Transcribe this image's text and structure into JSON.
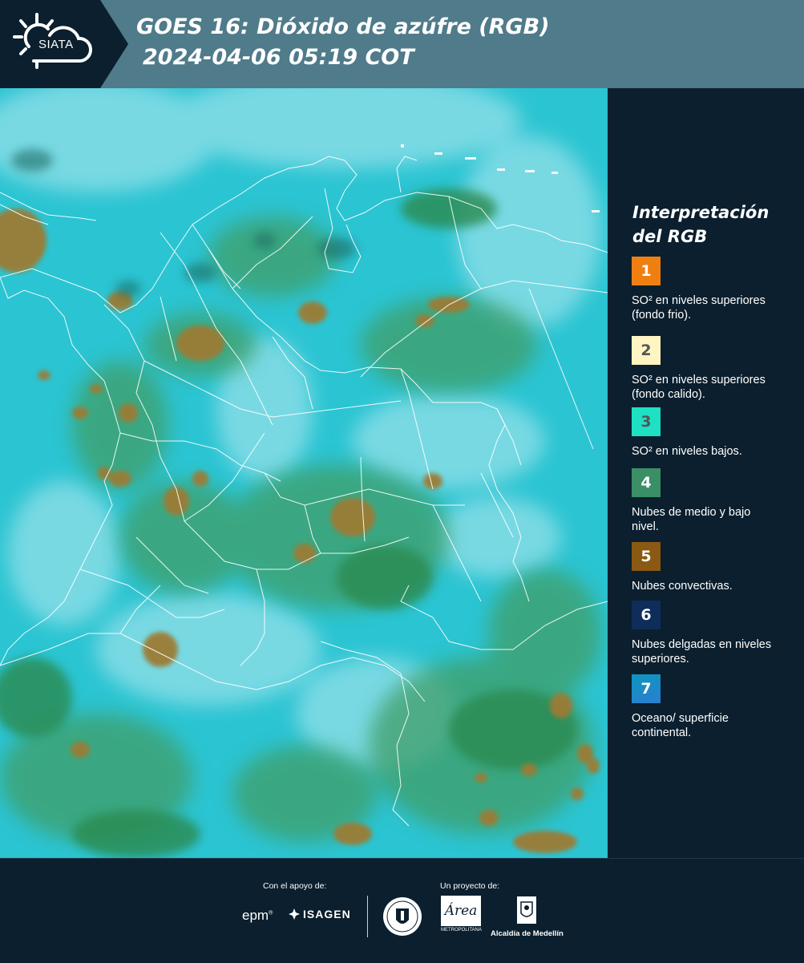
{
  "header": {
    "logo_text": "SIATA",
    "title_line1": "GOES 16: Dióxido de azúfre (RGB)",
    "title_line2": "2024-04-06 05:19 COT"
  },
  "legend": {
    "title_line1": "Interpretación",
    "title_line2": "del RGB",
    "items": [
      {
        "number": "1",
        "color": "#f07f12",
        "text_color": "#ffffff",
        "label": "SO² en niveles superiores (fondo frio)."
      },
      {
        "number": "2",
        "color": "#fff5c2",
        "text_color": "#555555",
        "label": "SO² en niveles superiores (fondo calido)."
      },
      {
        "number": "3",
        "color": "#1ee0c2",
        "text_color": "#555555",
        "label": "SO² en niveles bajos."
      },
      {
        "number": "4",
        "color": "#3b8f67",
        "text_color": "#ffffff",
        "label": "Nubes de medio y bajo nivel."
      },
      {
        "number": "5",
        "color": "#8a5a12",
        "text_color": "#ffffff",
        "label": "Nubes convectivas."
      },
      {
        "number": "6",
        "color": "#0e2d5a",
        "text_color": "#ffffff",
        "label": "Nubes delgadas en niveles superiores."
      },
      {
        "number": "7",
        "color": "#0d96bf",
        "text_color": "#ffffff",
        "label": "Oceano/ superficie continental."
      }
    ]
  },
  "footer": {
    "support_label": "Con el apoyo de:",
    "support_logos": [
      "epm",
      "ISAGEN"
    ],
    "project_label": "Un proyecto de:",
    "area_logo_text": "Área",
    "area_logo_subtext": "METROPOLITANA",
    "alcaldia_name": "Alcaldía de Medellín"
  },
  "map": {
    "background_color": "#2bc4d2",
    "cloud_colors": [
      "#7ad8e2",
      "#4aa57a",
      "#2f8f53",
      "#a0863f",
      "#8a6a2a"
    ]
  }
}
